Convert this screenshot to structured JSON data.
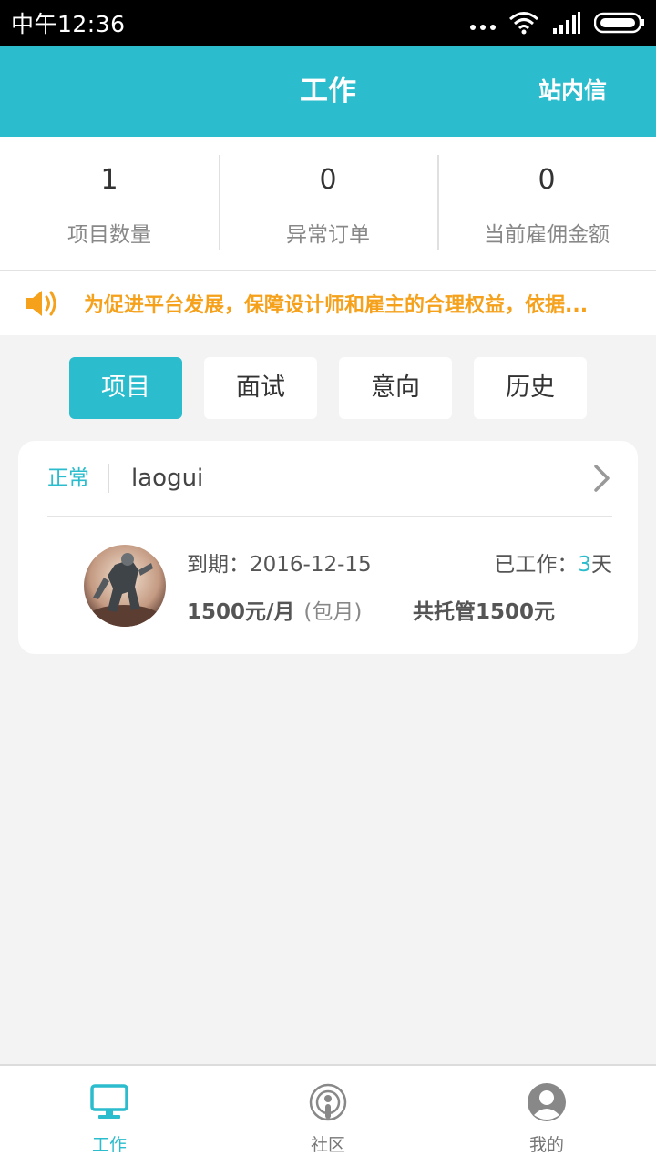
{
  "status_bar": {
    "time": "中午12:36"
  },
  "header": {
    "title": "工作",
    "action": "站内信"
  },
  "stats": [
    {
      "value": "1",
      "label": "项目数量"
    },
    {
      "value": "0",
      "label": "异常订单"
    },
    {
      "value": "0",
      "label": "当前雇佣金额"
    }
  ],
  "notice": {
    "text": "为促进平台发展，保障设计师和雇主的合理权益，依据..."
  },
  "tabs": [
    {
      "label": "项目",
      "active": true
    },
    {
      "label": "面试",
      "active": false
    },
    {
      "label": "意向",
      "active": false
    },
    {
      "label": "历史",
      "active": false
    }
  ],
  "card": {
    "status": "正常",
    "name": "laogui",
    "expire_label": "到期：",
    "expire_date": "2016-12-15",
    "worked_label": "已工作：",
    "worked_days": "3",
    "worked_unit": "天",
    "price": "1500元/月",
    "price_type": "(包月)",
    "escrow": "共托管1500元"
  },
  "bottom_nav": [
    {
      "label": "工作",
      "icon": "monitor-icon",
      "active": true
    },
    {
      "label": "社区",
      "icon": "podcast-icon",
      "active": false
    },
    {
      "label": "我的",
      "icon": "user-icon",
      "active": false
    }
  ],
  "colors": {
    "accent": "#2bbccd",
    "notice": "#f5a11b"
  }
}
